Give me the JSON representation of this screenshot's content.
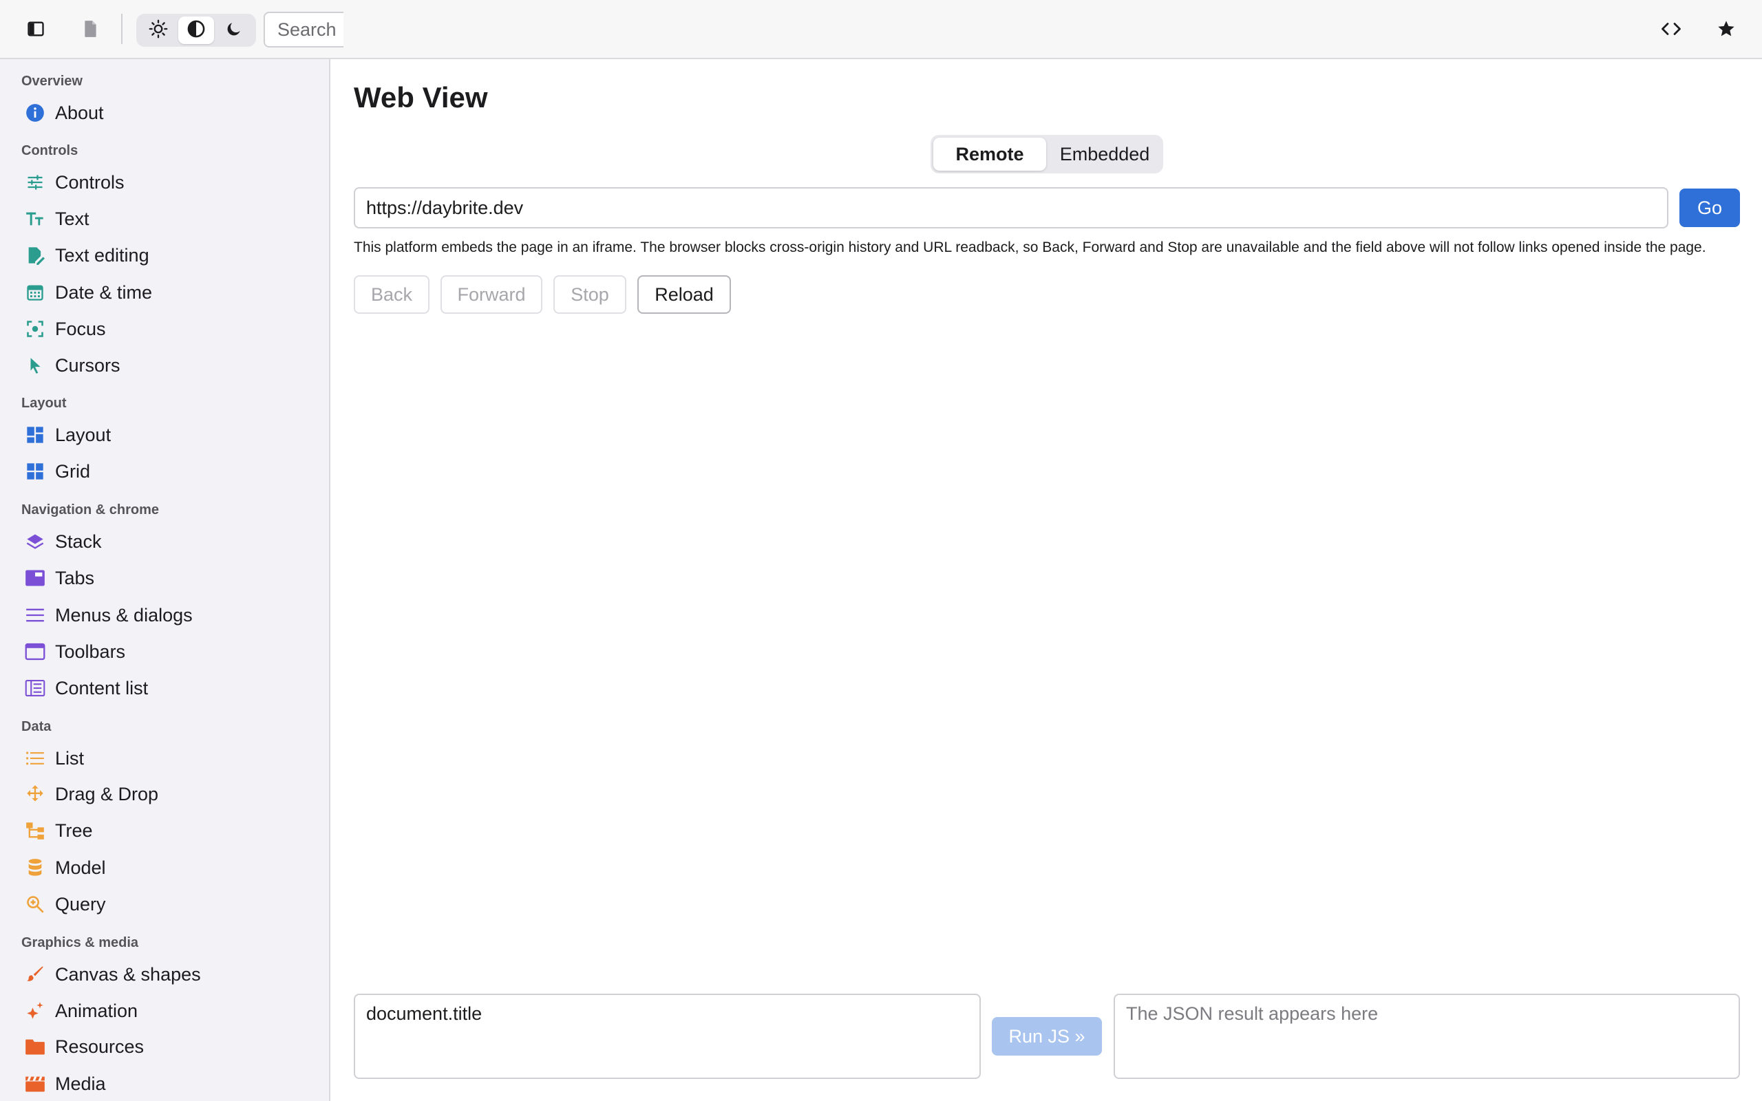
{
  "colors": {
    "accent": "#2f6fd8",
    "controls_icons": "#2a9d8f",
    "layout_icons": "#2f6fd8",
    "navigation_icons": "#7b4fd6",
    "data_icons": "#f0a23a",
    "graphics_icons": "#e8622a"
  },
  "topbar": {
    "search_placeholder": "Search",
    "icons": [
      "sidebar-toggle-icon",
      "document-icon",
      "sun-icon",
      "contrast-icon",
      "moon-icon",
      "code-icon",
      "star-icon"
    ],
    "active_theme": "contrast"
  },
  "sidebar": {
    "sections": [
      {
        "title": "Overview",
        "items": [
          {
            "label": "About",
            "icon": "info-icon"
          }
        ]
      },
      {
        "title": "Controls",
        "items": [
          {
            "label": "Controls",
            "icon": "sliders-icon"
          },
          {
            "label": "Text",
            "icon": "text-size-icon"
          },
          {
            "label": "Text editing",
            "icon": "edit-document-icon"
          },
          {
            "label": "Date & time",
            "icon": "calendar-icon"
          },
          {
            "label": "Focus",
            "icon": "focus-icon"
          },
          {
            "label": "Cursors",
            "icon": "cursor-icon"
          }
        ]
      },
      {
        "title": "Layout",
        "items": [
          {
            "label": "Layout",
            "icon": "dashboard-icon"
          },
          {
            "label": "Grid",
            "icon": "grid-icon"
          }
        ]
      },
      {
        "title": "Navigation & chrome",
        "items": [
          {
            "label": "Stack",
            "icon": "layers-icon"
          },
          {
            "label": "Tabs",
            "icon": "tab-icon"
          },
          {
            "label": "Menus & dialogs",
            "icon": "menu-icon"
          },
          {
            "label": "Toolbars",
            "icon": "window-icon"
          },
          {
            "label": "Content list",
            "icon": "content-list-icon"
          }
        ]
      },
      {
        "title": "Data",
        "items": [
          {
            "label": "List",
            "icon": "list-icon"
          },
          {
            "label": "Drag & Drop",
            "icon": "move-icon"
          },
          {
            "label": "Tree",
            "icon": "tree-icon"
          },
          {
            "label": "Model",
            "icon": "database-icon"
          },
          {
            "label": "Query",
            "icon": "search-zoom-icon"
          }
        ]
      },
      {
        "title": "Graphics & media",
        "items": [
          {
            "label": "Canvas & shapes",
            "icon": "brush-icon"
          },
          {
            "label": "Animation",
            "icon": "sparkle-icon"
          },
          {
            "label": "Resources",
            "icon": "folder-icon"
          },
          {
            "label": "Media",
            "icon": "clapperboard-icon"
          }
        ]
      }
    ]
  },
  "main": {
    "title": "Web View",
    "segments": [
      "Remote",
      "Embedded"
    ],
    "active_segment": "Remote",
    "url_value": "https://daybrite.dev",
    "go_label": "Go",
    "note": "This platform embeds the page in an iframe. The browser blocks cross-origin history and URL readback, so Back, Forward and Stop are unavailable and the field above will not follow links opened inside the page.",
    "nav_buttons": [
      {
        "label": "Back",
        "enabled": false
      },
      {
        "label": "Forward",
        "enabled": false
      },
      {
        "label": "Stop",
        "enabled": false
      },
      {
        "label": "Reload",
        "enabled": true
      }
    ],
    "js_input_value": "document.title",
    "run_label": "Run JS »",
    "result_placeholder": "The JSON result appears here"
  }
}
